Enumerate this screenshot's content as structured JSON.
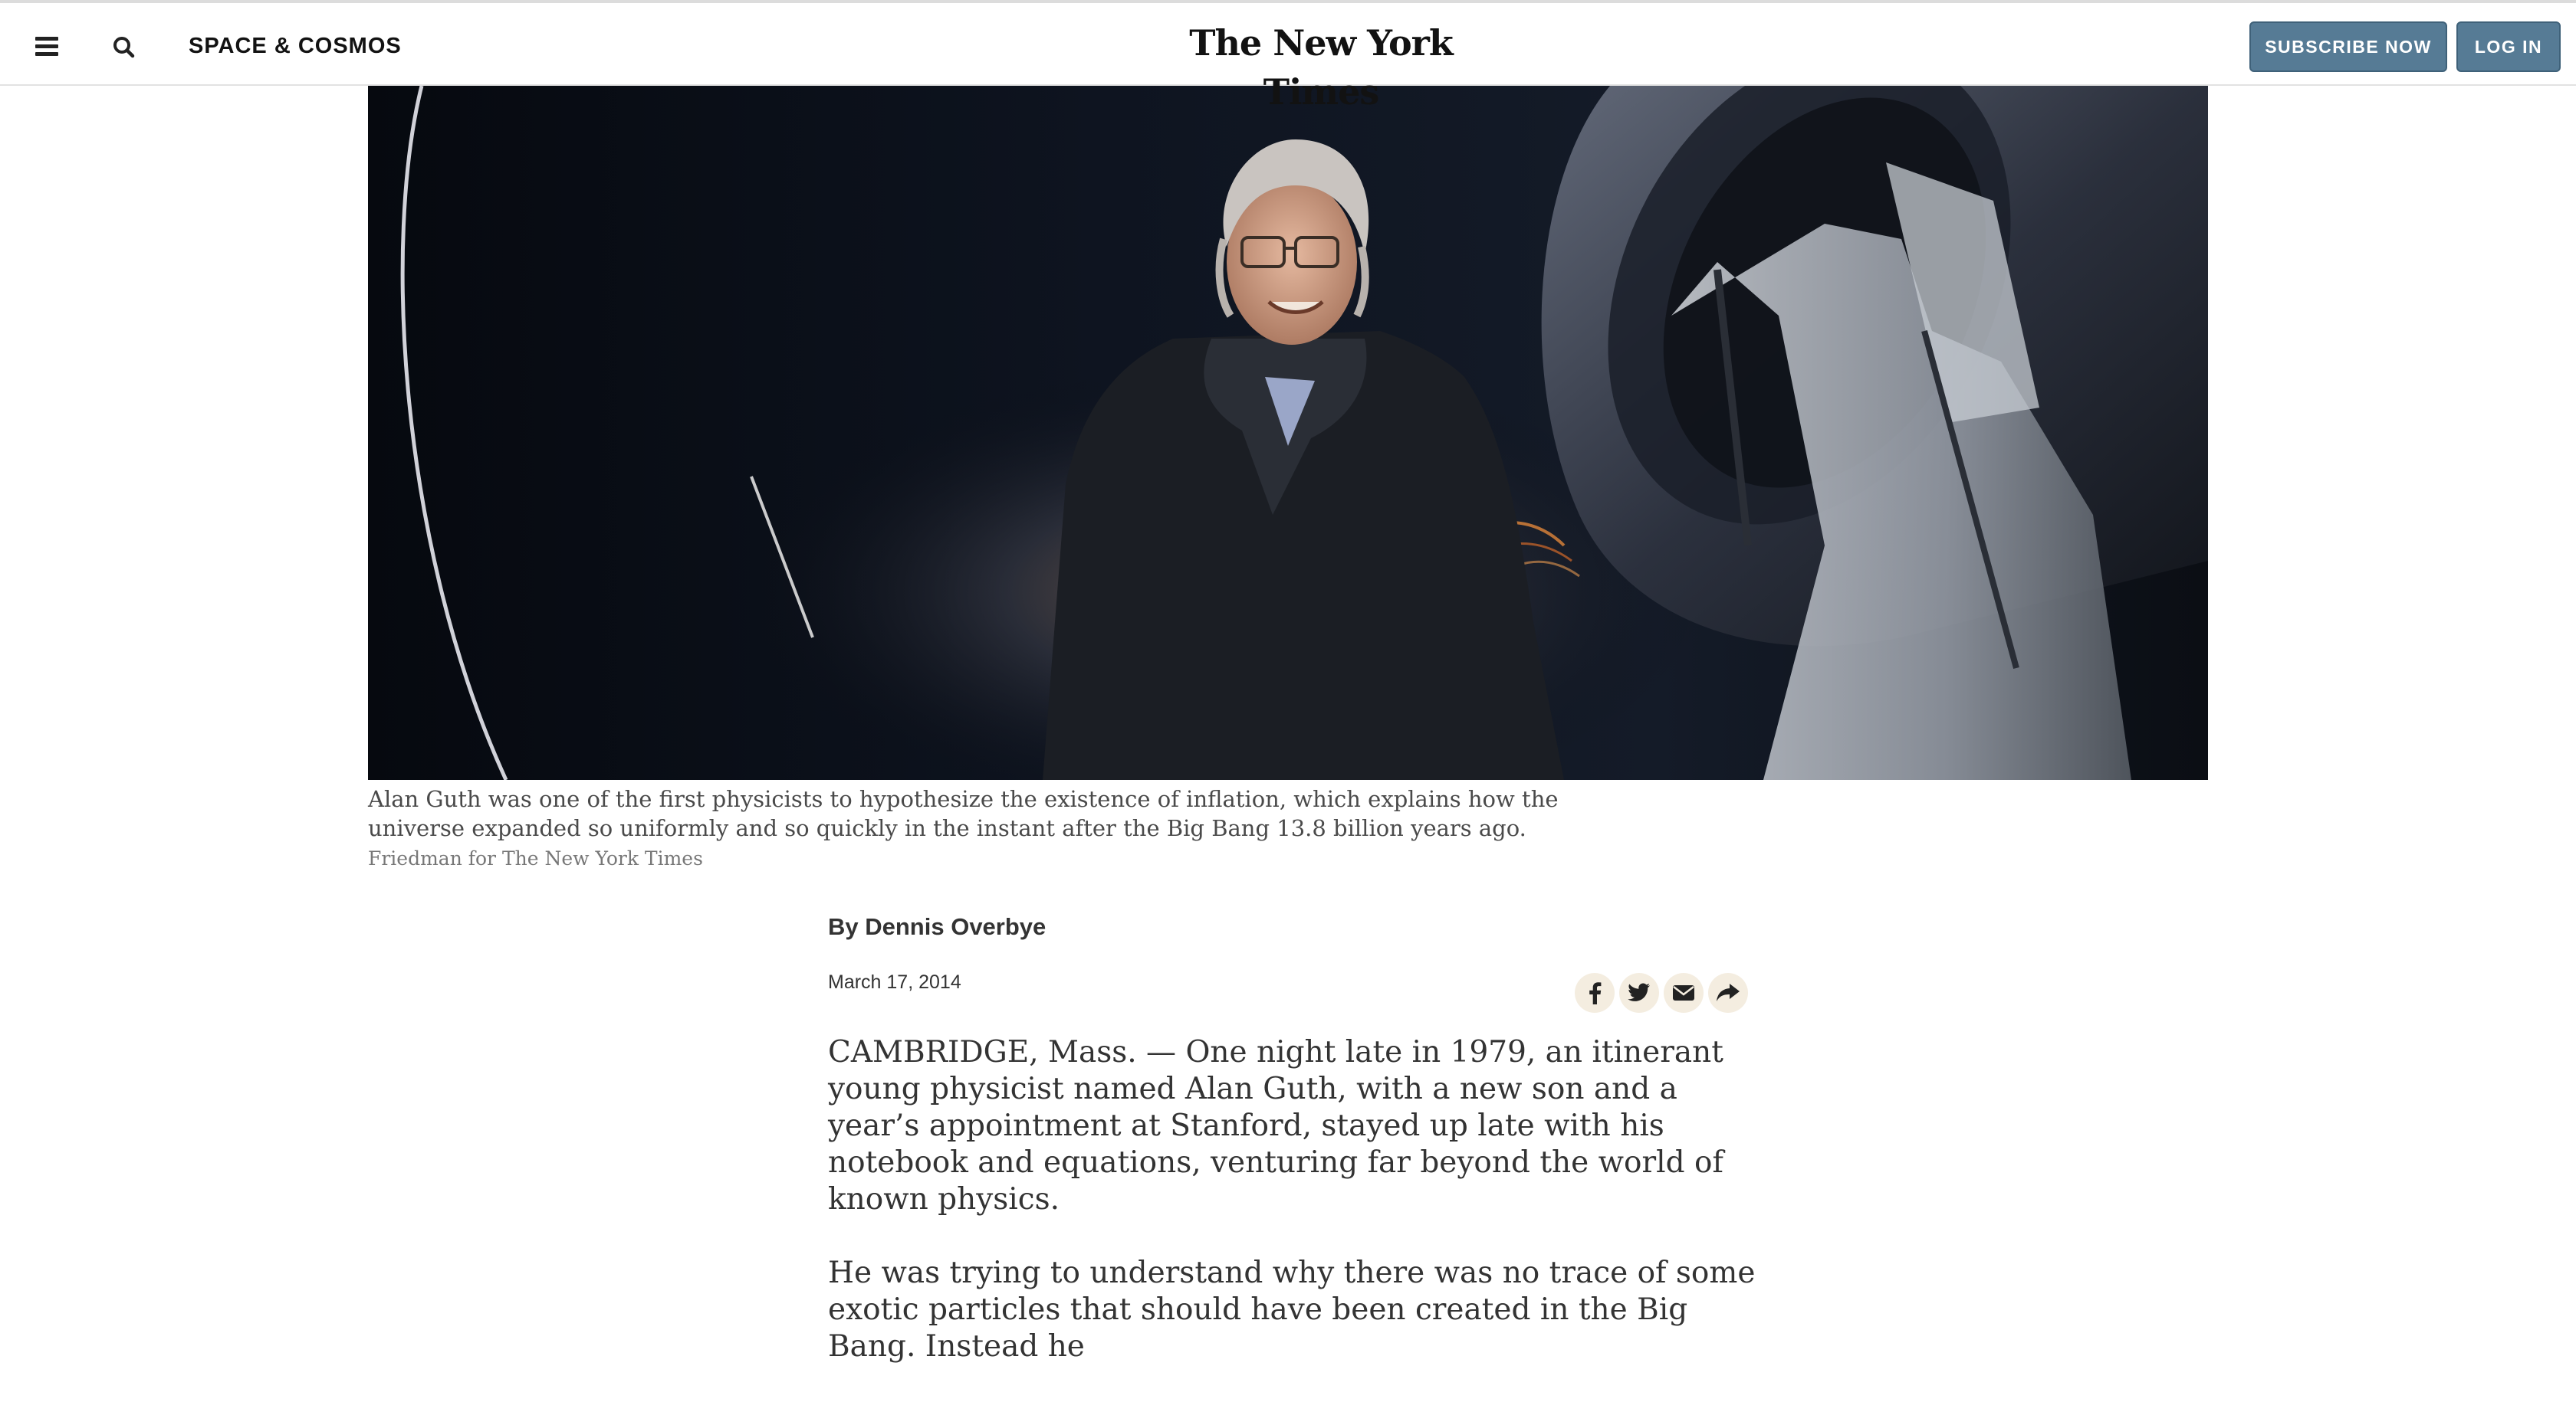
{
  "header": {
    "section": "SPACE & COSMOS",
    "logo": "The New York Times",
    "subscribe_label": "SUBSCRIBE NOW",
    "login_label": "LOG IN",
    "colors": {
      "button_bg": "#567b95",
      "text": "#121212"
    }
  },
  "hero": {
    "caption": "Alan Guth was one of the first physicists to hypothesize the existence of inflation, which explains how the universe expanded so uniformly and so quickly in the instant after the Big Bang 13.8 billion years ago.",
    "credit": "Friedman for The New York Times"
  },
  "article": {
    "byline": "By Dennis Overbye",
    "date": "March 17, 2014",
    "paragraphs": [
      "CAMBRIDGE, Mass. — One night late in 1979, an itinerant young physicist named Alan Guth, with a new son and a year’s appointment at Stanford, stayed up late with his notebook and equations, venturing far beyond the world of known physics.",
      "He was trying to understand why there was no trace of some exotic particles that should have been created in the Big Bang. Instead he"
    ]
  },
  "share": {
    "icons": [
      "facebook-icon",
      "twitter-icon",
      "email-icon",
      "share-icon"
    ]
  }
}
